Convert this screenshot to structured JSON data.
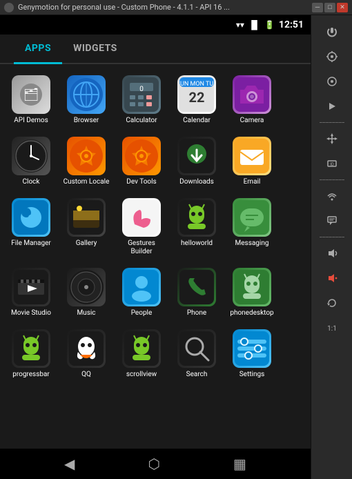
{
  "titleBar": {
    "text": "Genymotion for personal use - Custom Phone - 4.1.1 - API 16 ...",
    "controls": [
      "minimize",
      "restore",
      "close"
    ]
  },
  "statusBar": {
    "time": "12:51",
    "icons": [
      "wifi",
      "signal",
      "battery"
    ]
  },
  "tabs": [
    {
      "id": "apps",
      "label": "APPS",
      "active": true
    },
    {
      "id": "widgets",
      "label": "WIDGETS",
      "active": false
    }
  ],
  "apps": [
    {
      "id": "api-demos",
      "label": "API Demos",
      "icon": "📁",
      "iconClass": "icon-folder"
    },
    {
      "id": "browser",
      "label": "Browser",
      "icon": "🌐",
      "iconClass": "icon-browser"
    },
    {
      "id": "calculator",
      "label": "Calculator",
      "icon": "🔢",
      "iconClass": "icon-calc"
    },
    {
      "id": "calendar",
      "label": "Calendar",
      "icon": "📅",
      "iconClass": "icon-calendar"
    },
    {
      "id": "camera",
      "label": "Camera",
      "icon": "📷",
      "iconClass": "icon-camera"
    },
    {
      "id": "clock",
      "label": "Clock",
      "icon": "🕐",
      "iconClass": "icon-clock"
    },
    {
      "id": "custom-locale",
      "label": "Custom Locale",
      "icon": "⚙",
      "iconClass": "icon-custom"
    },
    {
      "id": "dev-tools",
      "label": "Dev Tools",
      "icon": "⚙",
      "iconClass": "icon-devtools"
    },
    {
      "id": "downloads",
      "label": "Downloads",
      "icon": "⬇",
      "iconClass": "icon-downloads"
    },
    {
      "id": "email",
      "label": "Email",
      "icon": "✉",
      "iconClass": "icon-email"
    },
    {
      "id": "file-manager",
      "label": "File Manager",
      "icon": "📁",
      "iconClass": "icon-filemanager"
    },
    {
      "id": "gallery",
      "label": "Gallery",
      "icon": "🖼",
      "iconClass": "icon-gallery"
    },
    {
      "id": "gestures-builder",
      "label": "Gestures Builder",
      "icon": "✋",
      "iconClass": "icon-gestures"
    },
    {
      "id": "helloworld",
      "label": "helloworld",
      "icon": "🤖",
      "iconClass": "icon-helloworld"
    },
    {
      "id": "messaging",
      "label": "Messaging",
      "icon": "💬",
      "iconClass": "icon-messaging"
    },
    {
      "id": "movie-studio",
      "label": "Movie Studio",
      "icon": "🎬",
      "iconClass": "icon-moviestudio"
    },
    {
      "id": "music",
      "label": "Music",
      "icon": "🎵",
      "iconClass": "icon-music"
    },
    {
      "id": "people",
      "label": "People",
      "icon": "👤",
      "iconClass": "icon-people"
    },
    {
      "id": "phone",
      "label": "Phone",
      "icon": "📞",
      "iconClass": "icon-phone"
    },
    {
      "id": "phonedesktop",
      "label": "phonedesktop",
      "icon": "📱",
      "iconClass": "icon-phonedesktop"
    },
    {
      "id": "progressbar",
      "label": "progressbar",
      "icon": "🤖",
      "iconClass": "icon-progressbar"
    },
    {
      "id": "qq",
      "label": "QQ",
      "icon": "🐧",
      "iconClass": "icon-qq"
    },
    {
      "id": "scrollview",
      "label": "scrollview",
      "icon": "🤖",
      "iconClass": "icon-scrollview"
    },
    {
      "id": "search",
      "label": "Search",
      "icon": "🔍",
      "iconClass": "icon-search"
    },
    {
      "id": "settings",
      "label": "Settings",
      "icon": "⚙",
      "iconClass": "icon-settings"
    }
  ],
  "sidebar": {
    "buttons": [
      {
        "id": "power",
        "icon": "⏻",
        "label": "power"
      },
      {
        "id": "gps",
        "icon": "📡",
        "label": "GPS"
      },
      {
        "id": "camera-sb",
        "icon": "⊙",
        "label": "camera"
      },
      {
        "id": "media",
        "icon": "▶",
        "label": "media"
      },
      {
        "id": "move",
        "icon": "✛",
        "label": "move"
      },
      {
        "id": "id-card",
        "icon": "🪪",
        "label": "id"
      },
      {
        "id": "divider1",
        "type": "divider"
      },
      {
        "id": "network",
        "icon": "((",
        "label": "network"
      },
      {
        "id": "message-sb",
        "icon": "▬",
        "label": "message"
      },
      {
        "id": "divider2",
        "type": "divider"
      },
      {
        "id": "vol-up",
        "icon": "🔊",
        "label": "volume-up"
      },
      {
        "id": "vol-down",
        "icon": "🔉",
        "label": "volume-down",
        "active": true
      },
      {
        "id": "rotate",
        "icon": "↻",
        "label": "rotate"
      },
      {
        "id": "zoom",
        "icon": "⊞",
        "label": "zoom"
      }
    ]
  },
  "navBar": {
    "back": "◀",
    "home": "⬡",
    "recents": "▦"
  }
}
